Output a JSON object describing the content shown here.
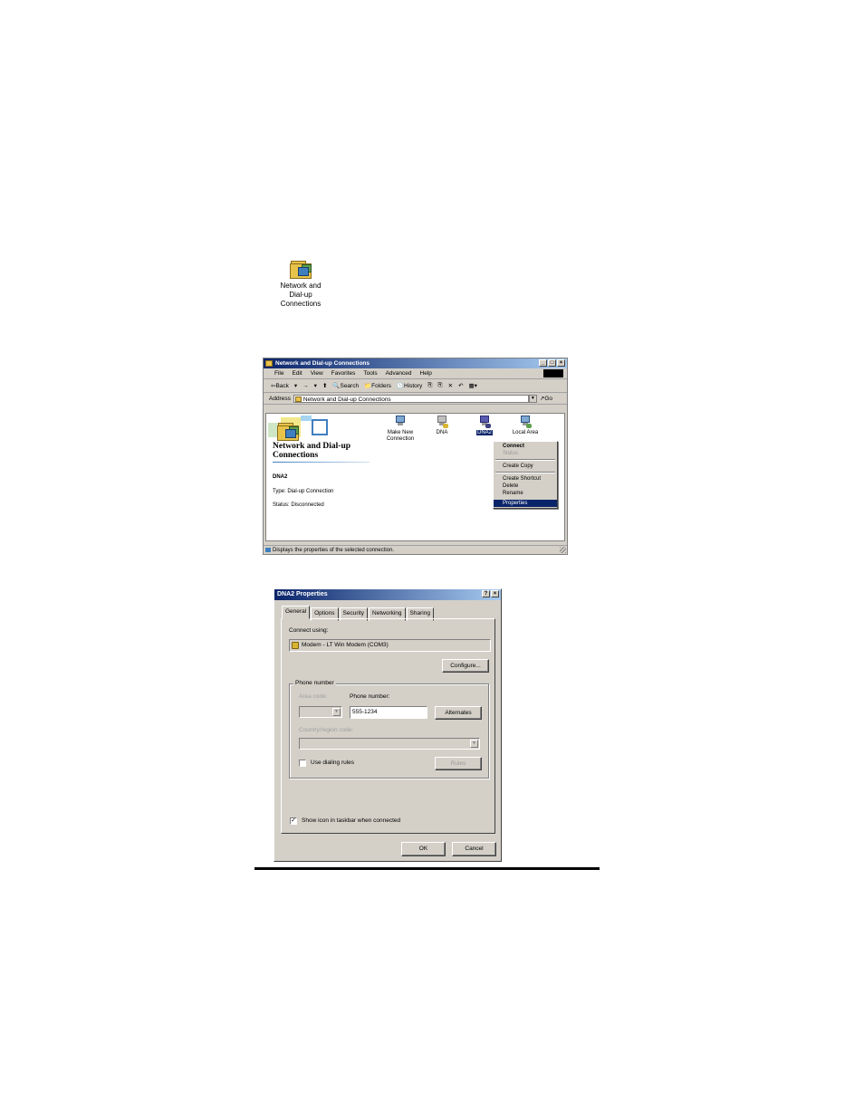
{
  "desktop_icon": {
    "label_lines": [
      "Network and",
      "Dial-up",
      "Connections"
    ]
  },
  "explorer": {
    "title": "Network and Dial-up Connections",
    "window_buttons": [
      "_",
      "□",
      "×"
    ],
    "menu": [
      "File",
      "Edit",
      "View",
      "Favorites",
      "Tools",
      "Advanced",
      "Help"
    ],
    "toolbar": [
      "⇦Back",
      "▾",
      "→",
      "▾",
      "⬆",
      "🔍Search",
      "📁Folders",
      "🕓History",
      "⎘",
      "⎘",
      "✕",
      "↶",
      "▦▾"
    ],
    "address_label": "Address",
    "address_value": "Network and Dial-up Connections",
    "go_label": "Go",
    "left_pane": {
      "title_lines": [
        "Network and Dial-up",
        "Connections"
      ],
      "selected_name": "DNA2",
      "type_text": "Type: Dial-up Connection",
      "status_text": "Status: Disconnected"
    },
    "icons": [
      {
        "label_lines": [
          "Make New",
          "Connection"
        ]
      },
      {
        "label_lines": [
          "DNA"
        ]
      },
      {
        "label_lines": [
          "DNA2"
        ]
      },
      {
        "label_lines": [
          "Local Area"
        ]
      }
    ],
    "context_menu": {
      "connect": "Connect",
      "status": "Status",
      "create_copy": "Create Copy",
      "create_shortcut": "Create Shortcut",
      "delete": "Delete",
      "rename": "Rename",
      "properties": "Properties"
    },
    "status_bar": "Displays the properties of the selected connection."
  },
  "dialog": {
    "title": "DNA2 Properties",
    "title_buttons": [
      "?",
      "×"
    ],
    "tabs": [
      "General",
      "Options",
      "Security",
      "Networking",
      "Sharing"
    ],
    "connect_using_label": "Connect using:",
    "device": "Modem - LT Win Modem (COM3)",
    "configure_button": "Configure...",
    "phone_group_label": "Phone number",
    "area_code_label": "Area code:",
    "phone_label": "Phone number:",
    "phone_value": "555-1234",
    "alternates_button": "Alternates",
    "country_label": "Country/region code:",
    "use_dialing_rules": "Use dialing rules",
    "rules_button": "Rules",
    "show_icon_label": "Show icon in taskbar when connected",
    "show_icon_checked": "✓",
    "ok_button": "OK",
    "cancel_button": "Cancel"
  }
}
